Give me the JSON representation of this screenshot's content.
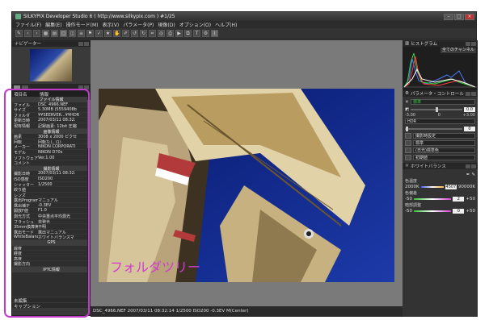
{
  "app": {
    "title": "SILKYPIX Developer Studio 6 ( http://www.silkypix.com )  #1/25"
  },
  "menu": [
    "ファイル(F)",
    "編集(E)",
    "操作モード(M)",
    "表示(V)",
    "パラメータ(P)",
    "現像(D)",
    "オプション(O)",
    "ヘルプ(H)"
  ],
  "navigator": {
    "title": "ナビゲーター"
  },
  "info": {
    "header_key": "項目名",
    "header_val": "情報",
    "sections": [
      {
        "title": "ファイル情報",
        "rows": [
          {
            "k": "ファイル",
            "v": "DSC_4966.NEF"
          },
          {
            "k": "サイズ",
            "v": "5.30MB (5559408b"
          },
          {
            "k": "フォルダ",
            "v": "¥¥SEERVER...¥¥HDR"
          },
          {
            "k": "更新日時",
            "v": "2007/03/11 08:32:"
          },
          {
            "k": "現有情報",
            "v": "記録画素: 12bit 圧縮"
          }
        ]
      },
      {
        "title": "画像情報",
        "rows": [
          {
            "k": "画素",
            "v": "3008 x 2000 ピクセ"
          },
          {
            "k": "回転",
            "v": "回転なし (1)"
          },
          {
            "k": "メーカー",
            "v": "NIKON CORPORATI"
          },
          {
            "k": "モデル",
            "v": "NIKON D70s"
          },
          {
            "k": "ソフトウェア",
            "v": "Ver.1.00"
          },
          {
            "k": "コメント",
            "v": ""
          }
        ]
      },
      {
        "title": "撮影情報",
        "rows": [
          {
            "k": "撮影日時",
            "v": "2007/03/11 08:32:"
          },
          {
            "k": "ISO感度",
            "v": "ISO200"
          },
          {
            "k": "シャッター",
            "v": "1/2500"
          },
          {
            "k": "絞り値",
            "v": ""
          },
          {
            "k": "レンズ",
            "v": ""
          },
          {
            "k": "露出Program",
            "v": "マニュアル"
          },
          {
            "k": "露出補正",
            "v": "-0.3EV"
          },
          {
            "k": "開放F値",
            "v": "F1.0"
          },
          {
            "k": "測光方式",
            "v": "中央重点平均測光"
          },
          {
            "k": "フラッシュ",
            "v": "非発光"
          },
          {
            "k": "35mm換算焦点",
            "v": "不明"
          },
          {
            "k": "露出モード",
            "v": "露出マニュアル"
          },
          {
            "k": "WhiteBalance",
            "v": "ホワイトバランスマ"
          }
        ]
      },
      {
        "title": "GPS",
        "rows": [
          {
            "k": "緯度",
            "v": ""
          },
          {
            "k": "経度",
            "v": ""
          },
          {
            "k": "高度",
            "v": ""
          },
          {
            "k": "撮影方向",
            "v": ""
          }
        ]
      },
      {
        "title": "IPTC情報",
        "rows": []
      }
    ],
    "bottom_1": "未編集",
    "bottom_2": "キャプション"
  },
  "photo": {
    "annotation": "フォルダツリー"
  },
  "status": "DSC_4966.NEF 2007/03/11 08:32:14 1/2500 ISO200 -0.3EV M(Center)",
  "histogram": {
    "title": "ヒストグラム",
    "channel": "全てのチャンネル"
  },
  "param": {
    "title": "パラメータ・コントロール",
    "mode": "標準",
    "exposure_value": "0.0",
    "scale_min": "-3.00",
    "scale_zero": "0",
    "scale_max": "+3.00",
    "hdr_label": "HDR",
    "hdr_value": "0",
    "style": "撮影時設定",
    "tone": "標準",
    "color": "(日光)標準色",
    "sharp": "初期値"
  },
  "wb": {
    "title": "ホワイトバランス",
    "temp_label": "色温度",
    "temp_min": "2000K",
    "temp_value": "4507",
    "temp_max": "90000K",
    "tint_label": "色偏差",
    "tint_min": "-50",
    "tint_value": "2",
    "tint_max": "+50",
    "dark_label": "暗部調整",
    "dark_min": "-50",
    "dark_value": "0",
    "dark_max": "+50"
  },
  "colors": {
    "annotation": "#d23ad0",
    "highlight": "#c23ac9",
    "accent_green": "#3bd14a"
  }
}
